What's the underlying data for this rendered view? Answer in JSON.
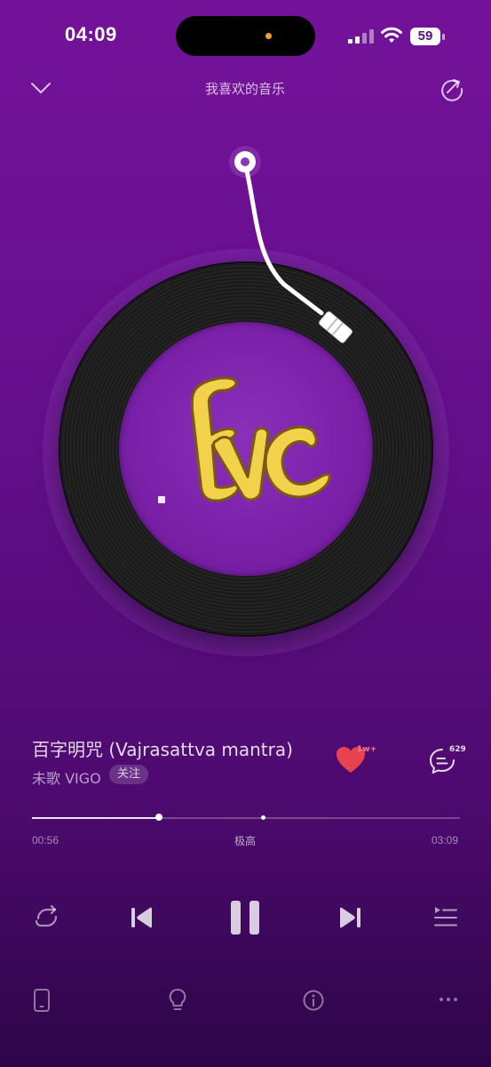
{
  "status_bar": {
    "time": "04:09",
    "battery": "59",
    "icons": [
      "cellular-signal-icon",
      "wifi-icon",
      "battery-icon"
    ]
  },
  "header": {
    "title": "我喜欢的音乐",
    "back_icon": "chevron-down-icon",
    "share_icon": "share-icon"
  },
  "album": {
    "cover_text": "ΞVC"
  },
  "song": {
    "title": "百字明咒 (Vajrasattva mantra)",
    "artist": "未歌 VIGO",
    "follow_label": "关注",
    "like_count": "1w+",
    "comment_count": "629",
    "liked": true
  },
  "progress": {
    "elapsed": "00:56",
    "duration": "03:09",
    "quality": "极高",
    "fraction": 0.2963,
    "marker_fraction": 0.54
  },
  "controls": [
    "repeat-icon",
    "previous-icon",
    "pause-icon",
    "next-icon",
    "playlist-icon"
  ],
  "bottom_bar": [
    "device-icon",
    "lightbulb-icon",
    "info-icon",
    "more-icon"
  ],
  "colors": {
    "background_top": "#74129a",
    "background_bottom": "#2e0548",
    "like_red": "#e8414f",
    "album_yellow": "#f2d24a"
  }
}
